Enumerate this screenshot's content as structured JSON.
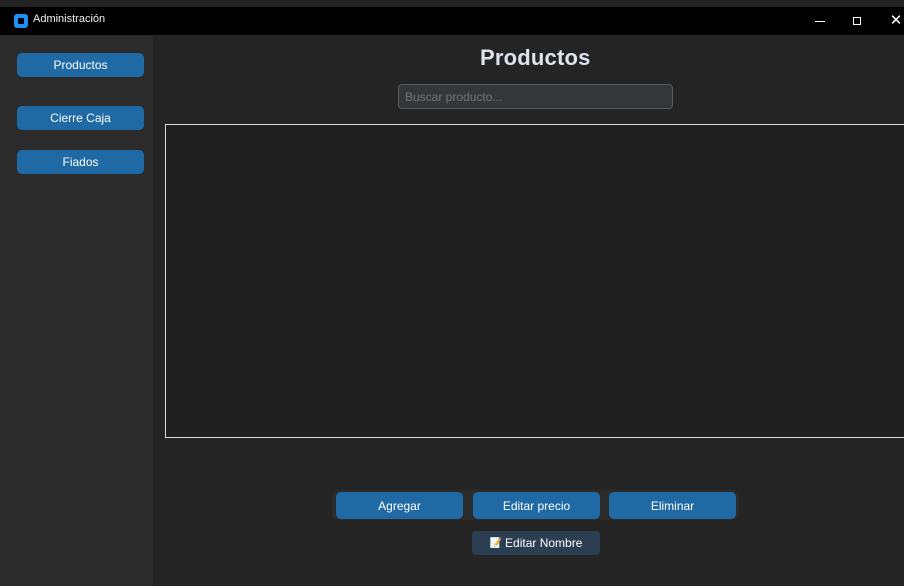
{
  "window": {
    "title": "Administración",
    "controls": {
      "minimize": "minimize-icon",
      "maximize": "maximize-icon",
      "close": "✕"
    }
  },
  "sidebar": {
    "items": [
      {
        "label": "Productos"
      },
      {
        "label": "Cierre Caja"
      },
      {
        "label": "Fiados"
      }
    ]
  },
  "main": {
    "title": "Productos",
    "search": {
      "placeholder": "Buscar producto..."
    },
    "actions": {
      "add": "Agregar",
      "edit_price": "Editar precio",
      "delete": "Eliminar",
      "edit_name": "Editar Nombre",
      "edit_name_icon": "📝"
    }
  },
  "colors": {
    "accent": "#1f6aa5",
    "secondary_button": "#2c3e52",
    "background": "#242424",
    "sidebar": "#2b2b2b"
  }
}
